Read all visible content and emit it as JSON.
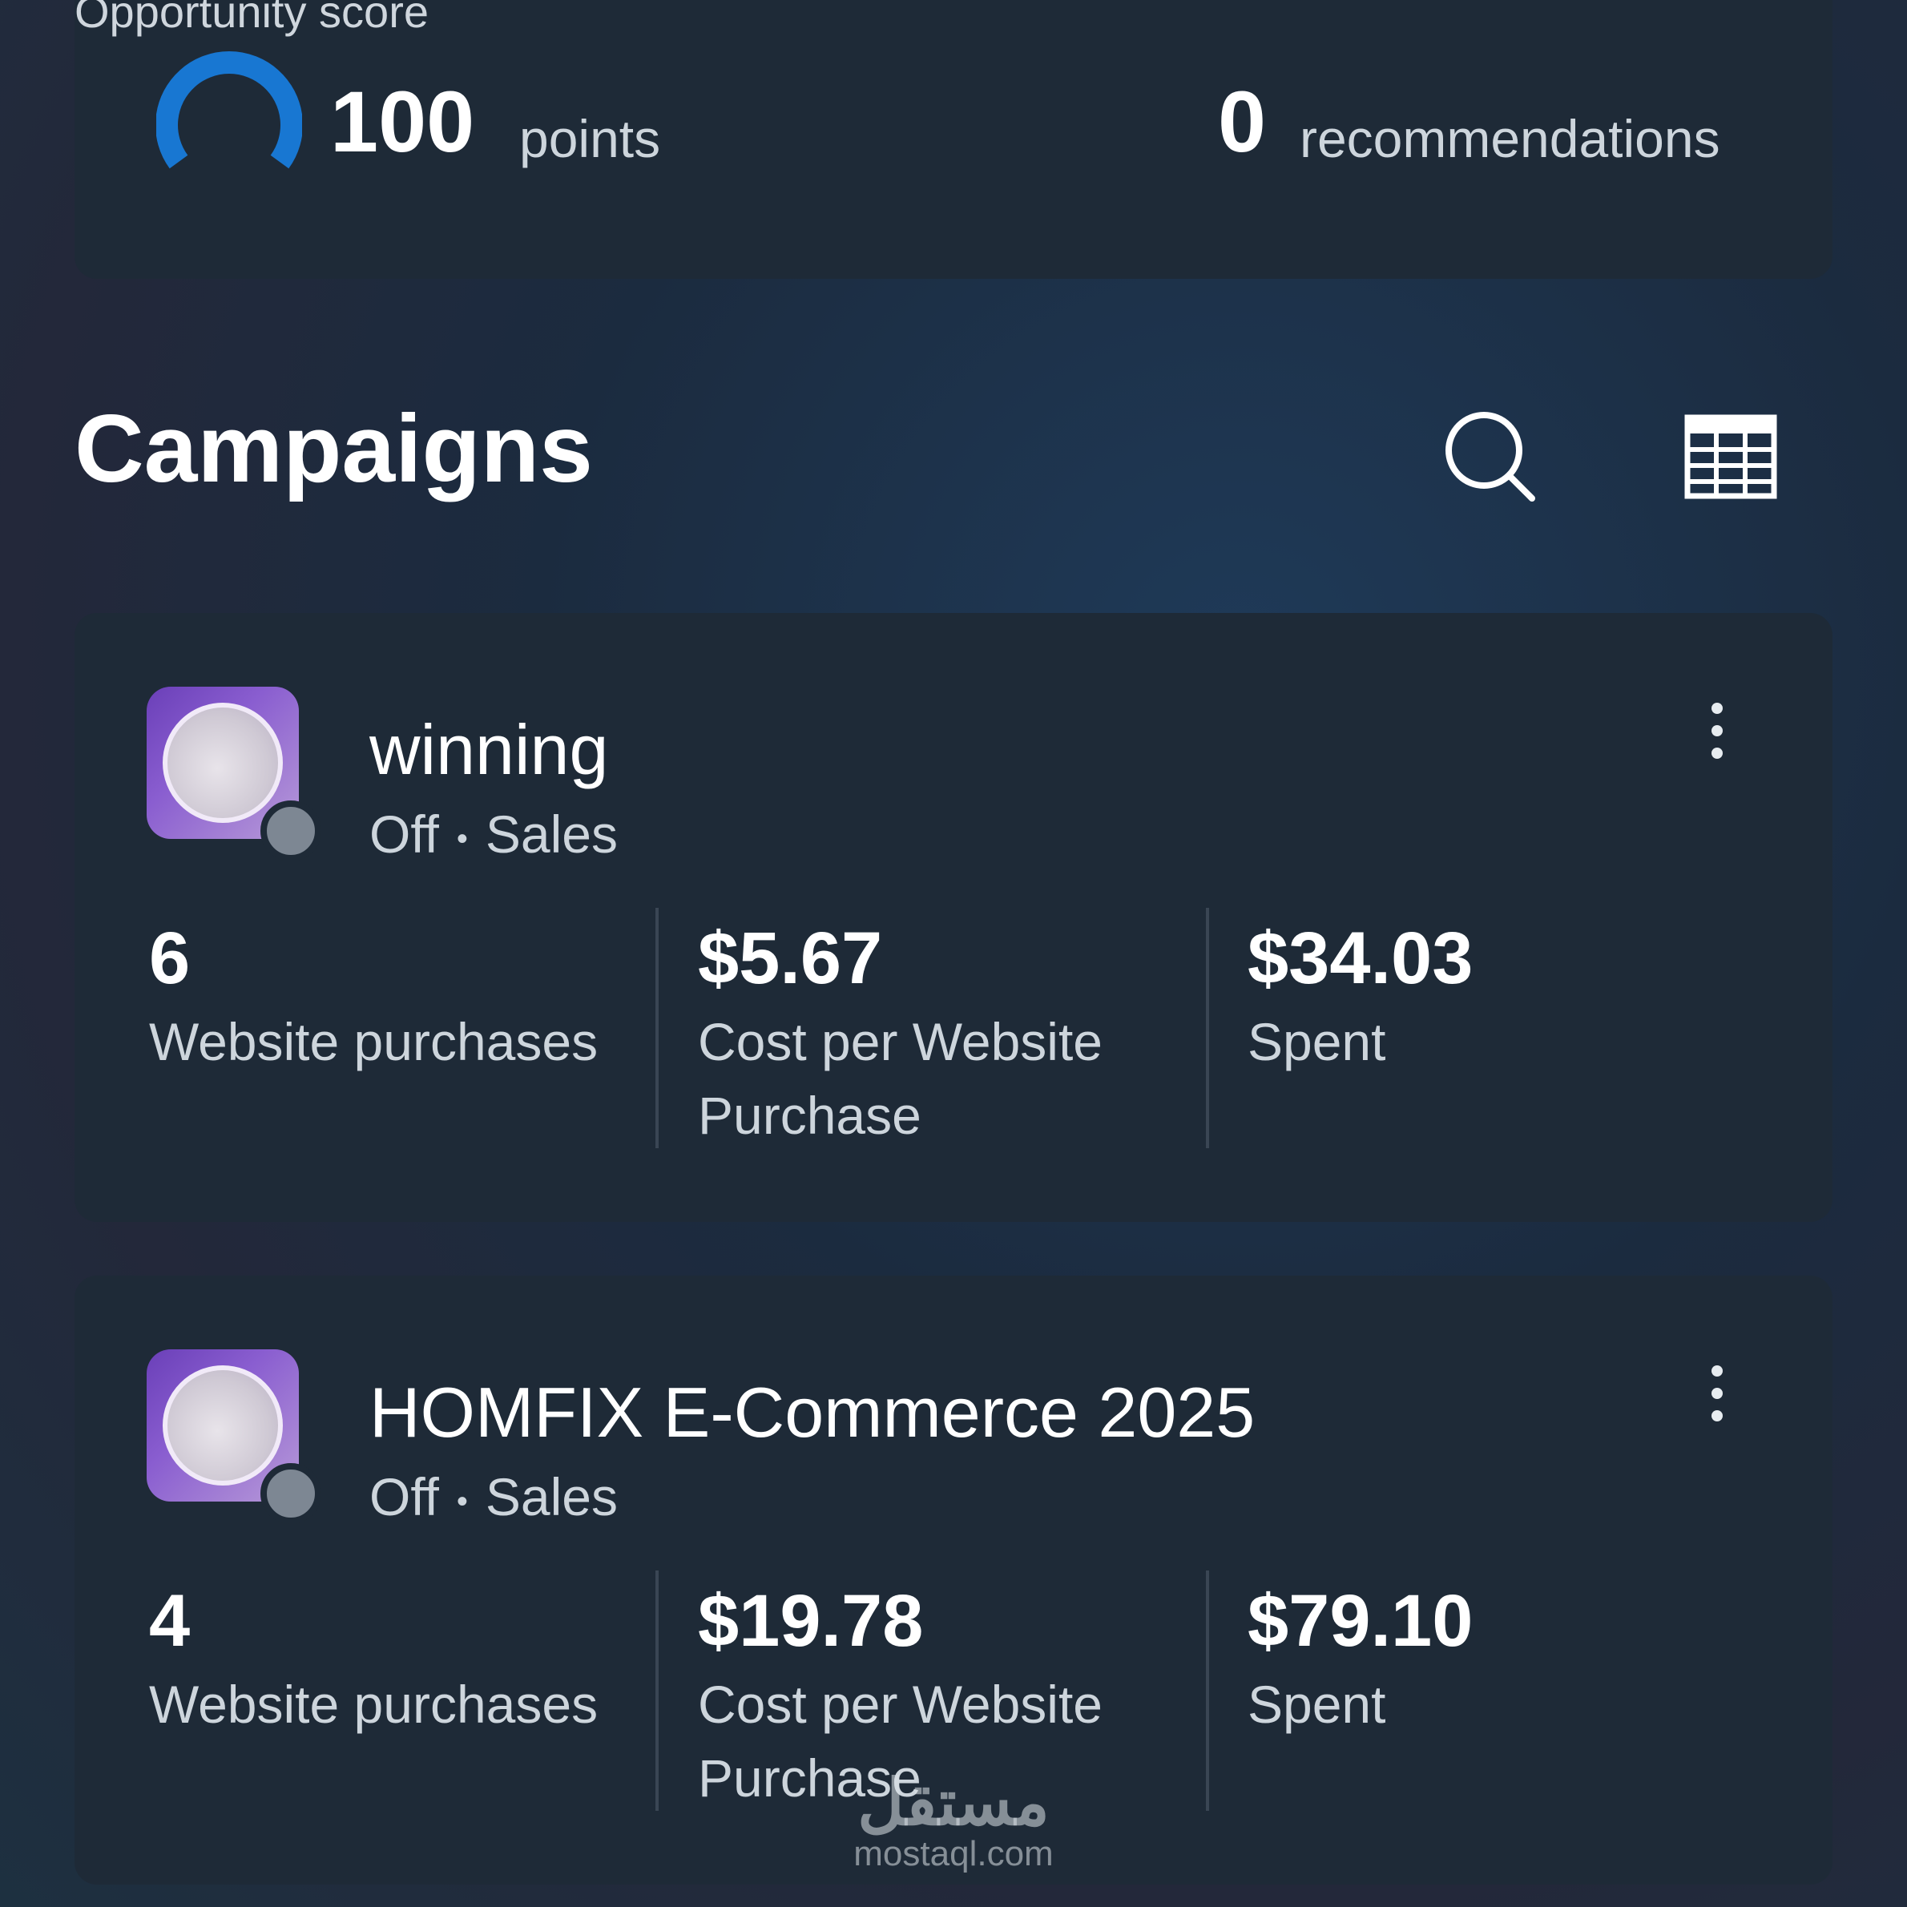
{
  "score": {
    "label": "Opportunity score",
    "points_value": "100",
    "points_label": "points",
    "recommendations_value": "0",
    "recommendations_label": "recommendations"
  },
  "campaigns_title": "Campaigns",
  "campaigns": [
    {
      "name": "winning",
      "status": "Off",
      "objective": "Sales",
      "metrics": [
        {
          "value": "6",
          "label": "Website purchases"
        },
        {
          "value": "$5.67",
          "label": "Cost per Website Purchase"
        },
        {
          "value": "$34.03",
          "label": "Spent"
        }
      ]
    },
    {
      "name": "HOMFIX E-Commerce 2025",
      "status": "Off",
      "objective": "Sales",
      "metrics": [
        {
          "value": "4",
          "label": "Website purchases"
        },
        {
          "value": "$19.78",
          "label": "Cost per Website Purchase"
        },
        {
          "value": "$79.10",
          "label": "Spent"
        }
      ]
    }
  ],
  "watermark": {
    "logo": "مستقل",
    "url": "mostaql.com"
  },
  "colors": {
    "gauge": "#1877d2",
    "card": "#1e2a37",
    "status_off": "#7d8793"
  }
}
